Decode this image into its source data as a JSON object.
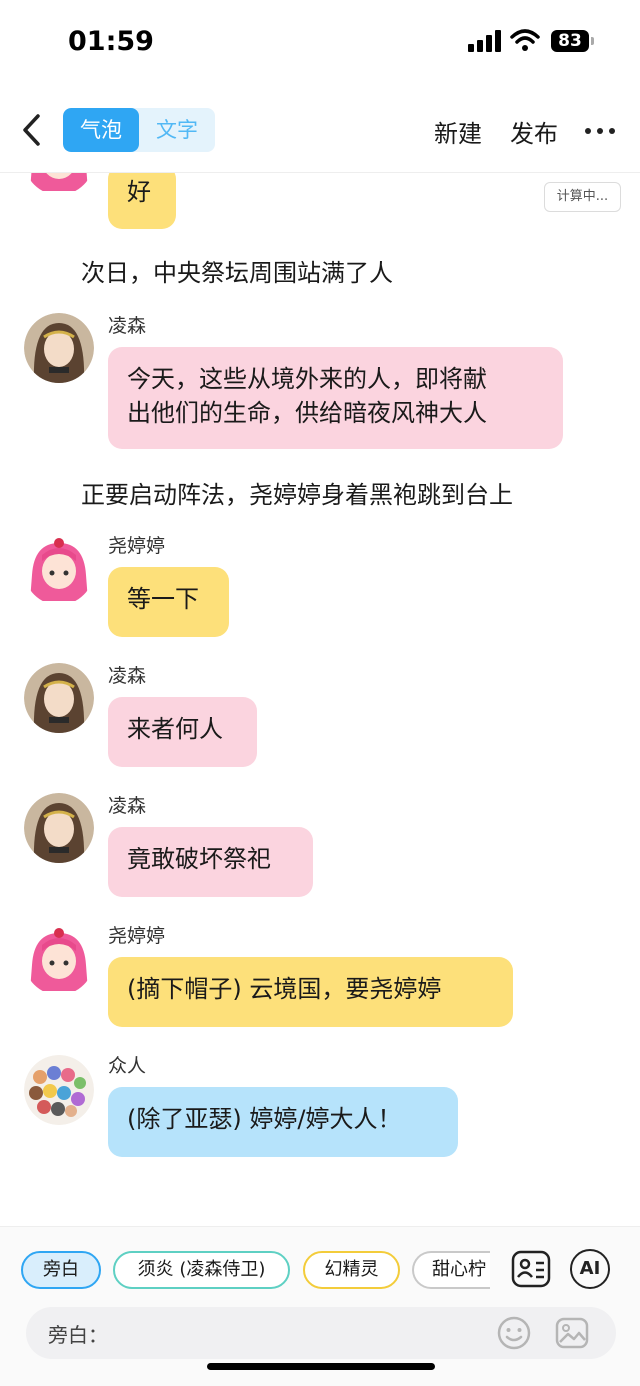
{
  "status": {
    "time": "01:59",
    "battery": "83"
  },
  "header": {
    "tab_bubble": "气泡",
    "tab_text": "文字",
    "new_label": "新建",
    "publish_label": "发布"
  },
  "chat": {
    "top_partial": {
      "text": "好",
      "status": "计算中..."
    },
    "narration1": "次日，中央祭坛周围站满了人",
    "msg1": {
      "name": "凌森",
      "line1": "今天，这些从境外来的人，即将献",
      "line2": "出他们的生命，供给暗夜风神大人"
    },
    "narration2": "正要启动阵法，尧婷婷身着黑袍跳到台上",
    "msg2": {
      "name": "尧婷婷",
      "text": "等一下"
    },
    "msg3": {
      "name": "凌森",
      "text": "来者何人"
    },
    "msg4": {
      "name": "凌森",
      "text": "竟敢破坏祭祀"
    },
    "msg5": {
      "name": "尧婷婷",
      "text": "(摘下帽子) 云境国，要尧婷婷"
    },
    "msg6": {
      "name": "众人",
      "text": "(除了亚瑟) 婷婷/婷大人！"
    }
  },
  "bottom": {
    "chips": [
      "旁白",
      "须炎 (凌森侍卫)",
      "幻精灵",
      "甜心柠"
    ],
    "ai_label": "AI",
    "input_label": "旁白："
  },
  "colors": {
    "accent_blue": "#2fa6f3",
    "bubble_pink": "#fbd4df",
    "bubble_yellow": "#fde07a",
    "bubble_blue": "#b6e3fb"
  },
  "icons": [
    "back-icon",
    "more-icon",
    "contact-card-icon",
    "emoji-icon",
    "image-icon",
    "signal-icon",
    "wifi-icon",
    "battery-icon"
  ]
}
